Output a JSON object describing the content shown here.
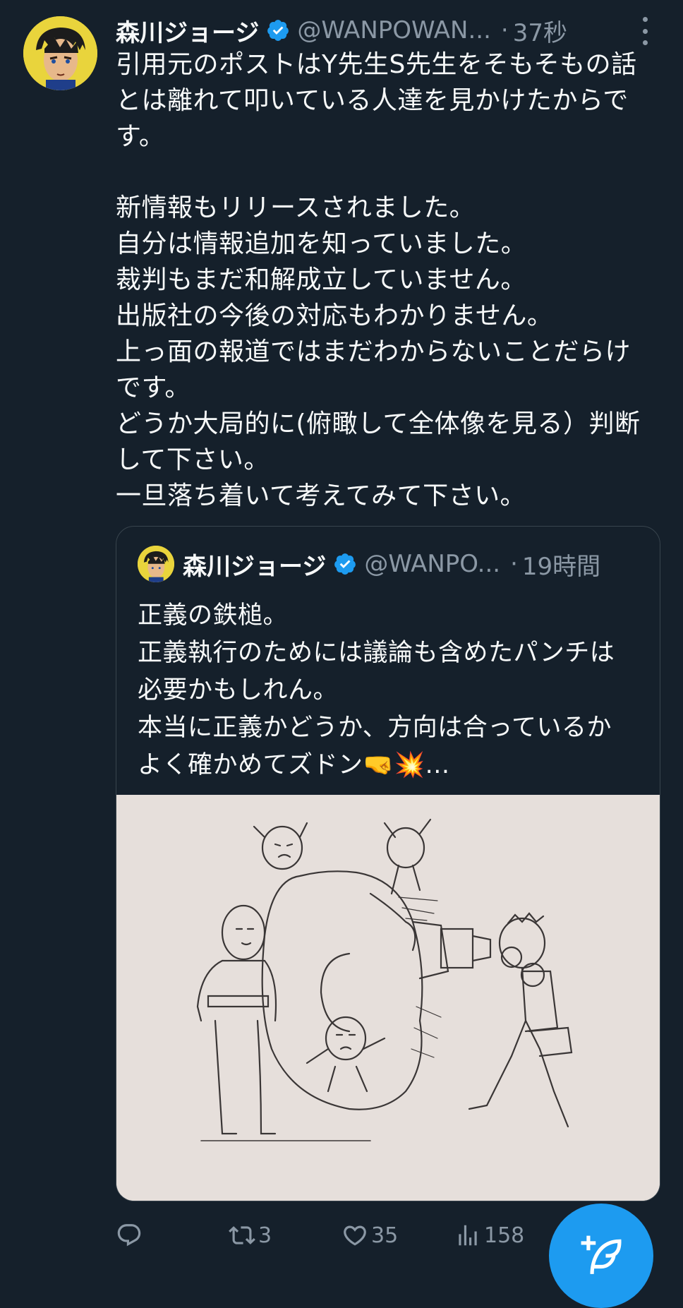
{
  "author": {
    "name": "森川ジョージ",
    "handle": "@WANPOWAN...",
    "time": "37秒"
  },
  "tweet_text": [
    "引用元のポストはY先生S先生をそもそもの話",
    "とは離れて叩いている人達を見かけたからで",
    "す。",
    "",
    "新情報もリリースされました。",
    "自分は情報追加を知っていました。",
    "裁判もまだ和解成立していません。",
    "出版社の今後の対応もわかりません。",
    "上っ面の報道ではまだわからないことだらけ",
    "です。",
    "どうか大局的に(俯瞰して全体像を見る）判断",
    "して下さい。",
    "一旦落ち着いて考えてみて下さい。"
  ],
  "quote": {
    "name": "森川ジョージ",
    "handle": "@WANPO...",
    "time": "19時間",
    "text": [
      "正義の鉄槌。",
      "正義執行のためには議論も含めたパンチは",
      "必要かもしれん。",
      "本当に正義かどうか、方向は合っているか",
      "よく確かめてズドン🤜💥..."
    ]
  },
  "actions": {
    "replies": "",
    "retweets": "3",
    "likes": "35",
    "views": "158"
  },
  "colors": {
    "background": "#15202b",
    "text": "#f7f9f9",
    "secondary": "#8b98a5",
    "accent": "#1d9bf0",
    "border": "#38444d"
  },
  "icons": [
    "verified-badge-icon",
    "more-options-icon",
    "reply-icon",
    "retweet-icon",
    "like-icon",
    "views-icon",
    "compose-icon"
  ]
}
